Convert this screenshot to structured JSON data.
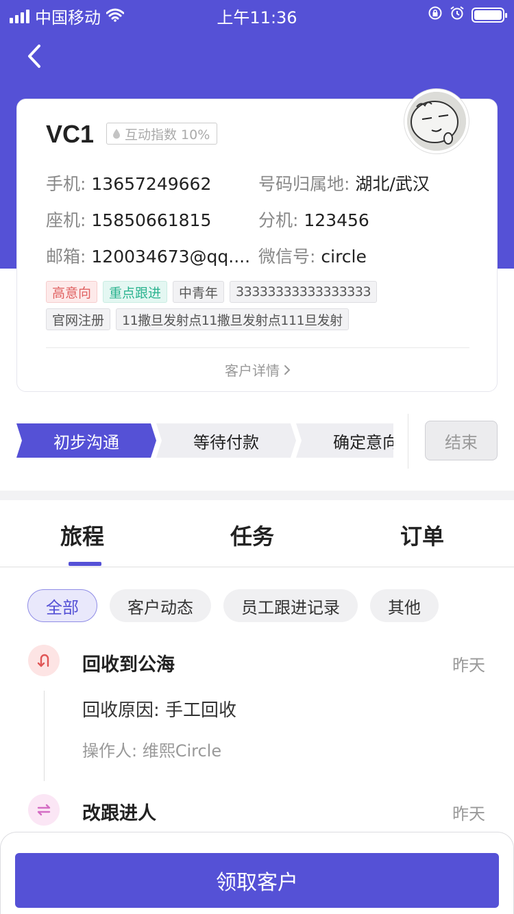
{
  "status_bar": {
    "carrier": "中国移动",
    "time": "上午11:36"
  },
  "nav": {
    "back_icon": "chevron-left-icon"
  },
  "customer": {
    "name": "VC1",
    "interaction_label": "互动指数 10%",
    "fields": {
      "mobile_label": "手机:",
      "mobile_value": "13657249662",
      "region_label": "号码归属地:",
      "region_value": "湖北/武汉",
      "landline_label": "座机:",
      "landline_value": "15850661815",
      "ext_label": "分机:",
      "ext_value": "123456",
      "email_label": "邮箱:",
      "email_value": "120034673@qq....",
      "wechat_label": "微信号:",
      "wechat_value": "circle"
    },
    "tags_row1": [
      "高意向",
      "重点跟进",
      "中青年",
      "33333333333333333"
    ],
    "tags_row2": [
      "官网注册",
      "11撒旦发射点11撒旦发射点111旦发射"
    ],
    "detail_link": "客户详情"
  },
  "stages": {
    "items": [
      "初步沟通",
      "等待付款",
      "确定意向"
    ],
    "active_index": 0,
    "end_label": "结束"
  },
  "tabs": [
    "旅程",
    "任务",
    "订单"
  ],
  "filters": [
    "全部",
    "客户动态",
    "员工跟进记录",
    "其他"
  ],
  "timeline": [
    {
      "icon": "u-turn-icon",
      "title": "回收到公海",
      "time": "昨天",
      "reason": "回收原因: 手工回收",
      "operator": "操作人: 维熙Circle"
    },
    {
      "icon": "swap-arrows-icon",
      "title": "改跟进人",
      "time": "昨天"
    }
  ],
  "action": {
    "claim_label": "领取客户"
  },
  "colors": {
    "brand": "#5551d6",
    "tag_red": "#e06060",
    "tag_green": "#2bb38f"
  }
}
